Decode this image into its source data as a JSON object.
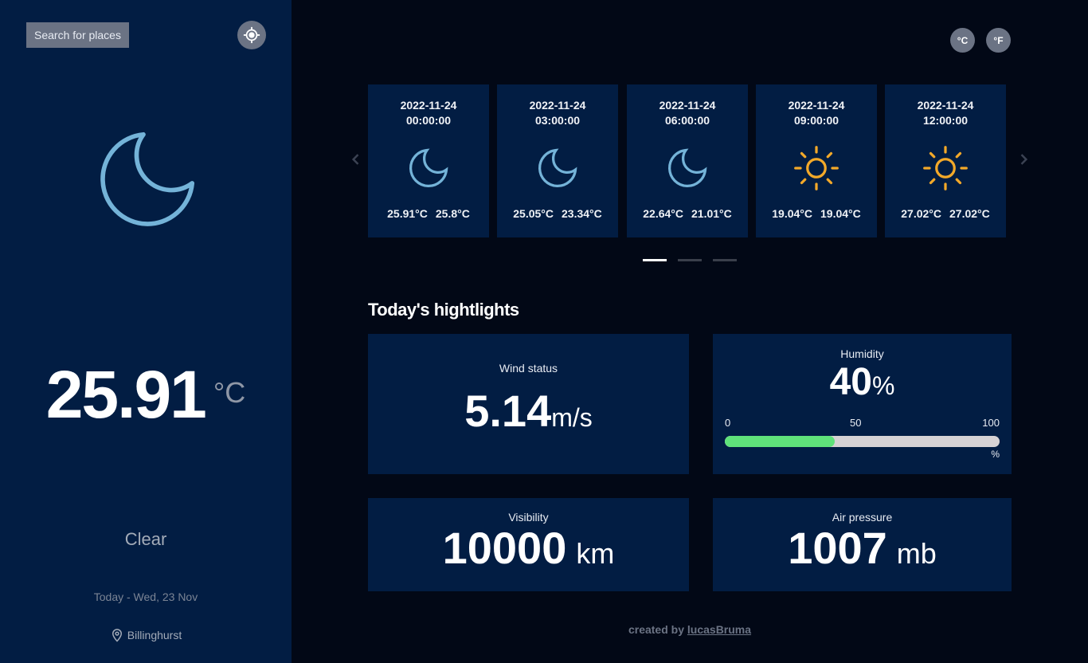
{
  "sidebar": {
    "search_label": "Search for places",
    "current_icon": "moon-icon",
    "temperature": "25.91",
    "unit": "°C",
    "condition": "Clear",
    "date": "Today - Wed, 23 Nov",
    "location": "Billinghurst"
  },
  "units": {
    "celsius": "°C",
    "fahrenheit": "°F"
  },
  "forecast": [
    {
      "date": "2022-11-24",
      "time": "00:00:00",
      "icon": "moon-icon",
      "temp_max": "25.91°C",
      "temp_min": "25.8°C"
    },
    {
      "date": "2022-11-24",
      "time": "03:00:00",
      "icon": "moon-icon",
      "temp_max": "25.05°C",
      "temp_min": "23.34°C"
    },
    {
      "date": "2022-11-24",
      "time": "06:00:00",
      "icon": "moon-icon",
      "temp_max": "22.64°C",
      "temp_min": "21.01°C"
    },
    {
      "date": "2022-11-24",
      "time": "09:00:00",
      "icon": "sun-icon",
      "temp_max": "19.04°C",
      "temp_min": "19.04°C"
    },
    {
      "date": "2022-11-24",
      "time": "12:00:00",
      "icon": "sun-icon",
      "temp_max": "27.02°C",
      "temp_min": "27.02°C"
    }
  ],
  "carousel": {
    "pages": 3,
    "active_page": 0
  },
  "highlights": {
    "title": "Today's hightlights",
    "wind": {
      "label": "Wind status",
      "value": "5.14",
      "unit": "m/s"
    },
    "humidity": {
      "label": "Humidity",
      "value": "40",
      "unit": "%",
      "percent": 40,
      "scale_min": "0",
      "scale_mid": "50",
      "scale_max": "100",
      "scale_unit": "%"
    },
    "visibility": {
      "label": "Visibility",
      "value": "10000",
      "unit": "km"
    },
    "pressure": {
      "label": "Air pressure",
      "value": "1007",
      "unit": "mb"
    }
  },
  "footer": {
    "prefix": "created by",
    "author": "lucasBruma"
  },
  "colors": {
    "moon": "#74b3d8",
    "sun": "#f3a929",
    "progress": "#5fe27a",
    "sidebar_bg": "#021d43",
    "page_bg": "#020816"
  }
}
